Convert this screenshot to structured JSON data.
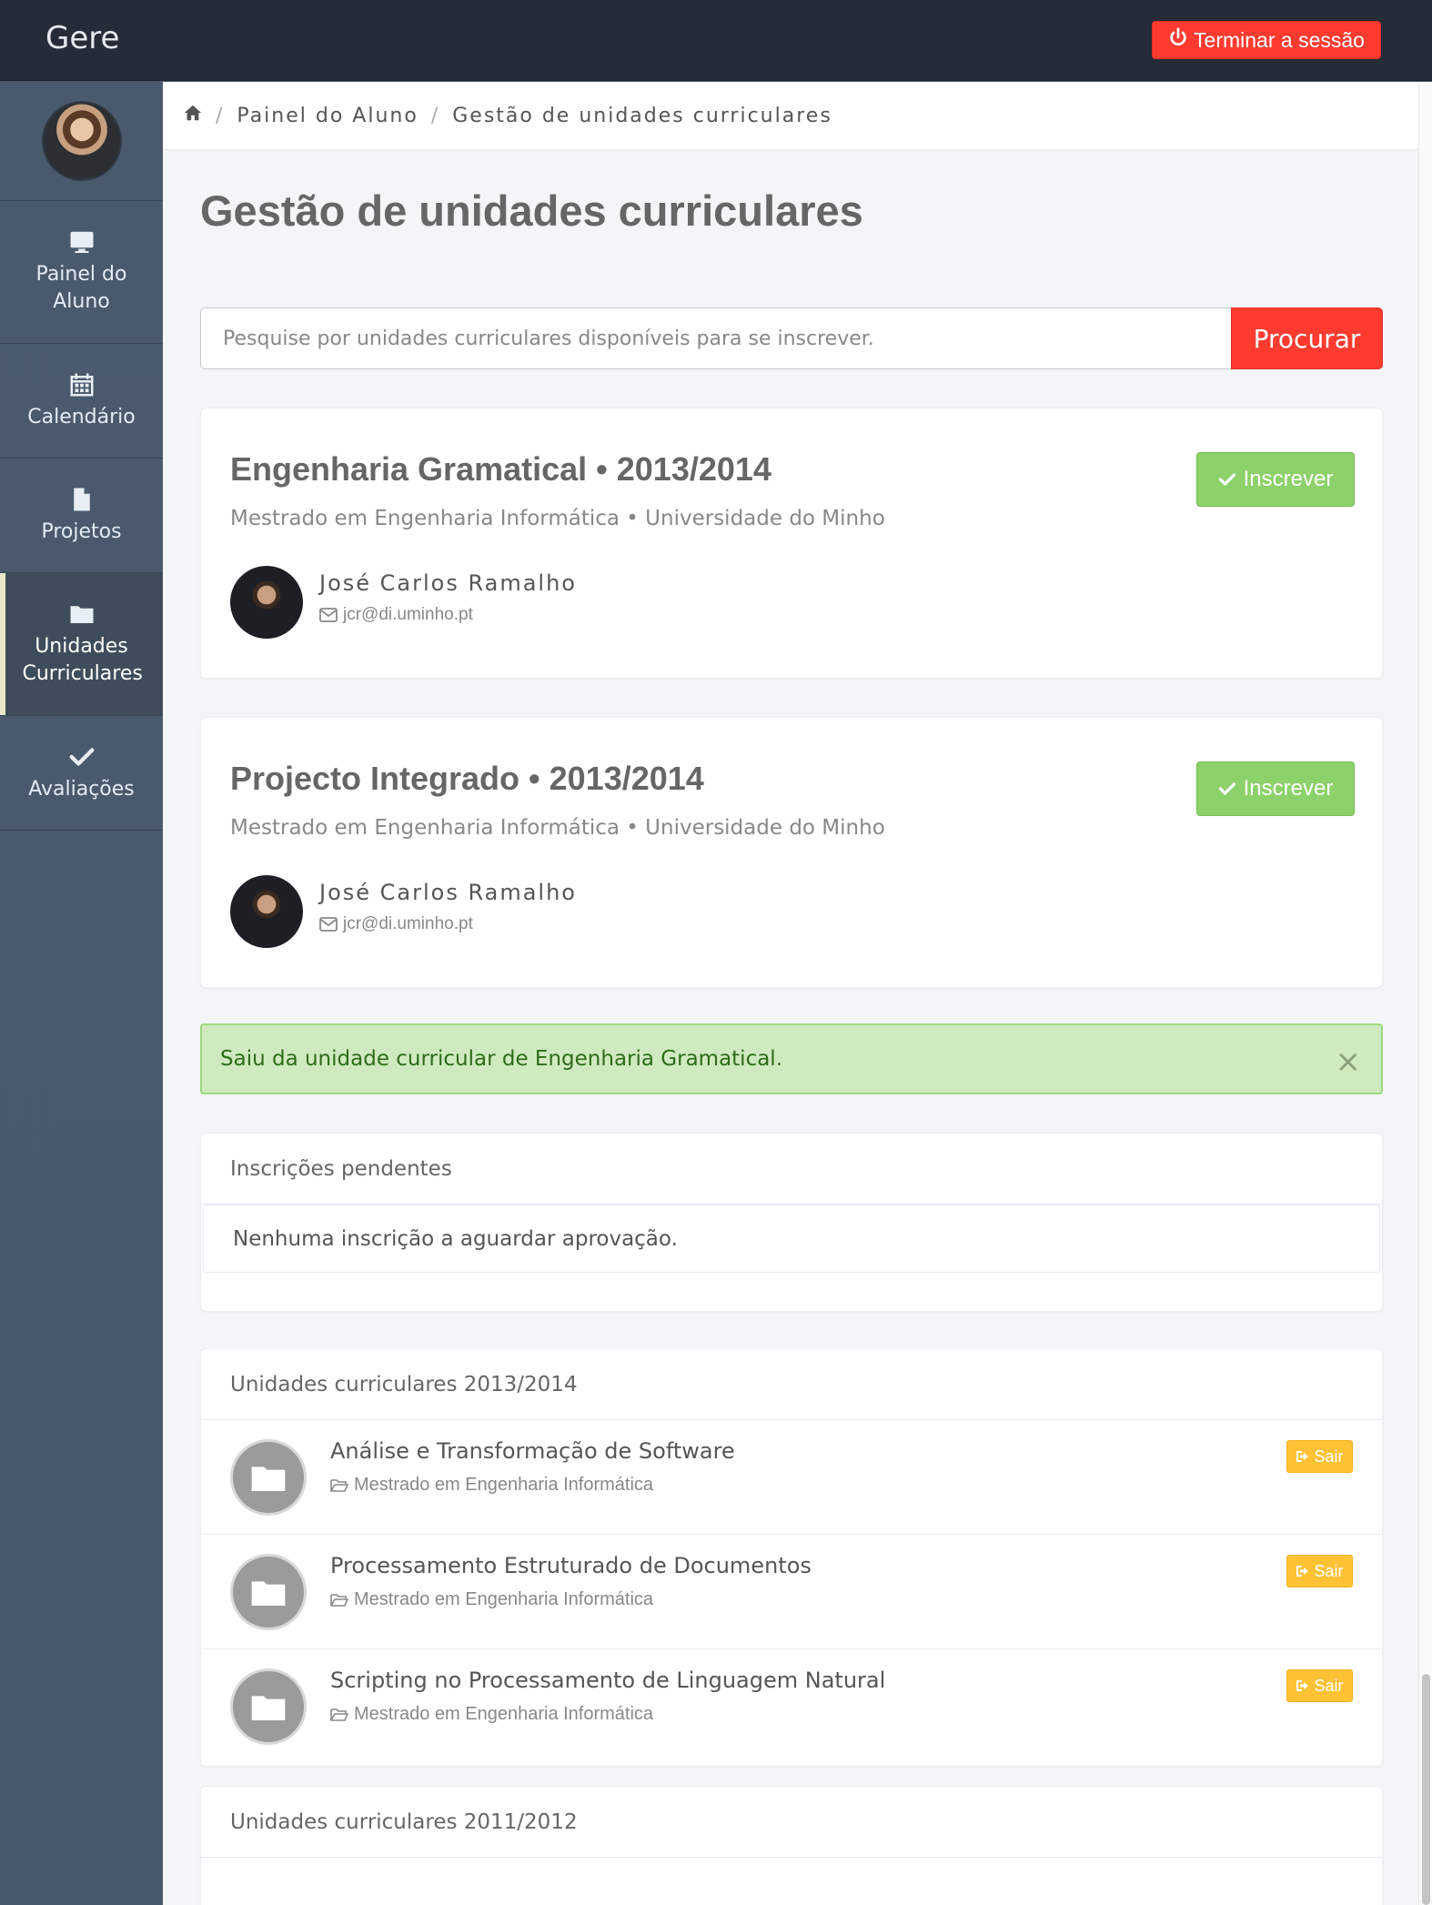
{
  "app": {
    "brand": "Gere",
    "logout_label": "Terminar a sessão"
  },
  "sidebar": {
    "items": [
      {
        "label": "Painel do Aluno",
        "icon": "monitor-icon",
        "active": false
      },
      {
        "label": "Calendário",
        "icon": "calendar-icon",
        "active": false
      },
      {
        "label": "Projetos",
        "icon": "file-icon",
        "active": false
      },
      {
        "label": "Unidades Curriculares",
        "icon": "folder-icon",
        "active": true
      },
      {
        "label": "Avaliações",
        "icon": "check-icon",
        "active": false
      }
    ]
  },
  "breadcrumb": {
    "items": [
      "Painel do Aluno",
      "Gestão de unidades curriculares"
    ]
  },
  "page": {
    "title": "Gestão de unidades curriculares"
  },
  "search": {
    "placeholder": "Pesquise por unidades curriculares disponíveis para se inscrever.",
    "button": "Procurar"
  },
  "courses": [
    {
      "title": "Engenharia Gramatical • 2013/2014",
      "subtitle": "Mestrado em Engenharia Informática • Universidade do Minho",
      "teacher": "José Carlos Ramalho",
      "email": "jcr@di.uminho.pt",
      "action": "Inscrever"
    },
    {
      "title": "Projecto Integrado • 2013/2014",
      "subtitle": "Mestrado em Engenharia Informática • Universidade do Minho",
      "teacher": "José Carlos Ramalho",
      "email": "jcr@di.uminho.pt",
      "action": "Inscrever"
    }
  ],
  "alert": {
    "message": "Saiu da unidade curricular de Engenharia Gramatical.",
    "close": "×"
  },
  "pending": {
    "title": "Inscrições pendentes",
    "empty": "Nenhuma inscrição a aguardar aprovação."
  },
  "enrolled_2013": {
    "title": "Unidades curriculares 2013/2014",
    "items": [
      {
        "name": "Análise e Transformação de Software",
        "degree": "Mestrado em Engenharia Informática",
        "action": "Sair"
      },
      {
        "name": "Processamento Estruturado de Documentos",
        "degree": "Mestrado em Engenharia Informática",
        "action": "Sair"
      },
      {
        "name": "Scripting no Processamento de Linguagem Natural",
        "degree": "Mestrado em Engenharia Informática",
        "action": "Sair"
      }
    ]
  },
  "enrolled_2011": {
    "title": "Unidades curriculares 2011/2012"
  },
  "colors": {
    "topbar": "#252c38",
    "sidebar": "#4a5a6c",
    "danger": "#ff3b30",
    "success": "#8dd16a",
    "warning": "#ffc235",
    "alert_bg": "#d0eabf"
  }
}
